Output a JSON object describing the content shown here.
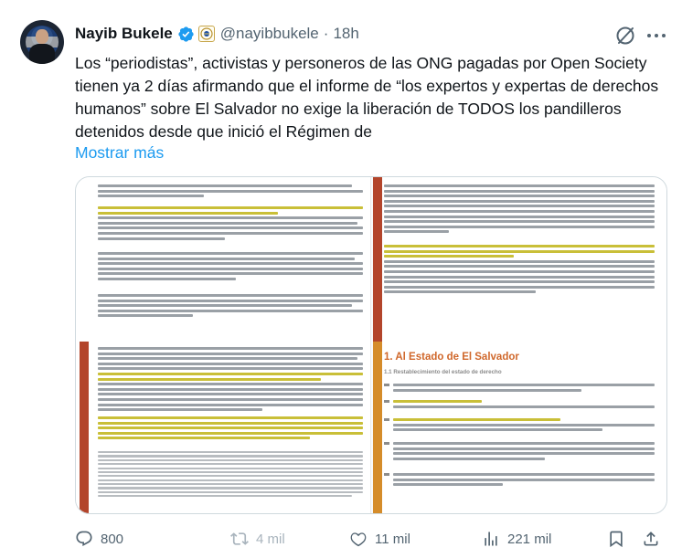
{
  "author": {
    "name": "Nayib Bukele",
    "handle": "@nayibbukele",
    "separator": "·",
    "time": "18h"
  },
  "tweet": {
    "text": "Los “periodistas”, activistas y personeros de las ONG pagadas por Open Society tienen ya 2 días afirmando que el informe de “los expertos y expertas de derechos humanos” sobre El Salvador no exige la liberación de TODOS los pandilleros detenidos desde que inició el Régimen de",
    "show_more": "Mostrar más"
  },
  "media": {
    "section_title": "1. Al Estado de El Salvador",
    "section_subtitle": "1.1 Restablecimiento del estado de derecho"
  },
  "actions": {
    "replies": "800",
    "reposts": "4 mil",
    "likes": "11 mil",
    "views": "221 mil"
  },
  "colors": {
    "link": "#1d9bf0",
    "secondary_text": "#536471",
    "verified": "#1d9bf0",
    "highlight": "#f2e530",
    "section_title": "#d0682c"
  },
  "icons": [
    "verified-badge-icon",
    "affiliation-seal-icon",
    "grok-icon",
    "more-icon",
    "reply-icon",
    "repost-icon",
    "like-icon",
    "views-icon",
    "bookmark-icon",
    "share-icon"
  ]
}
